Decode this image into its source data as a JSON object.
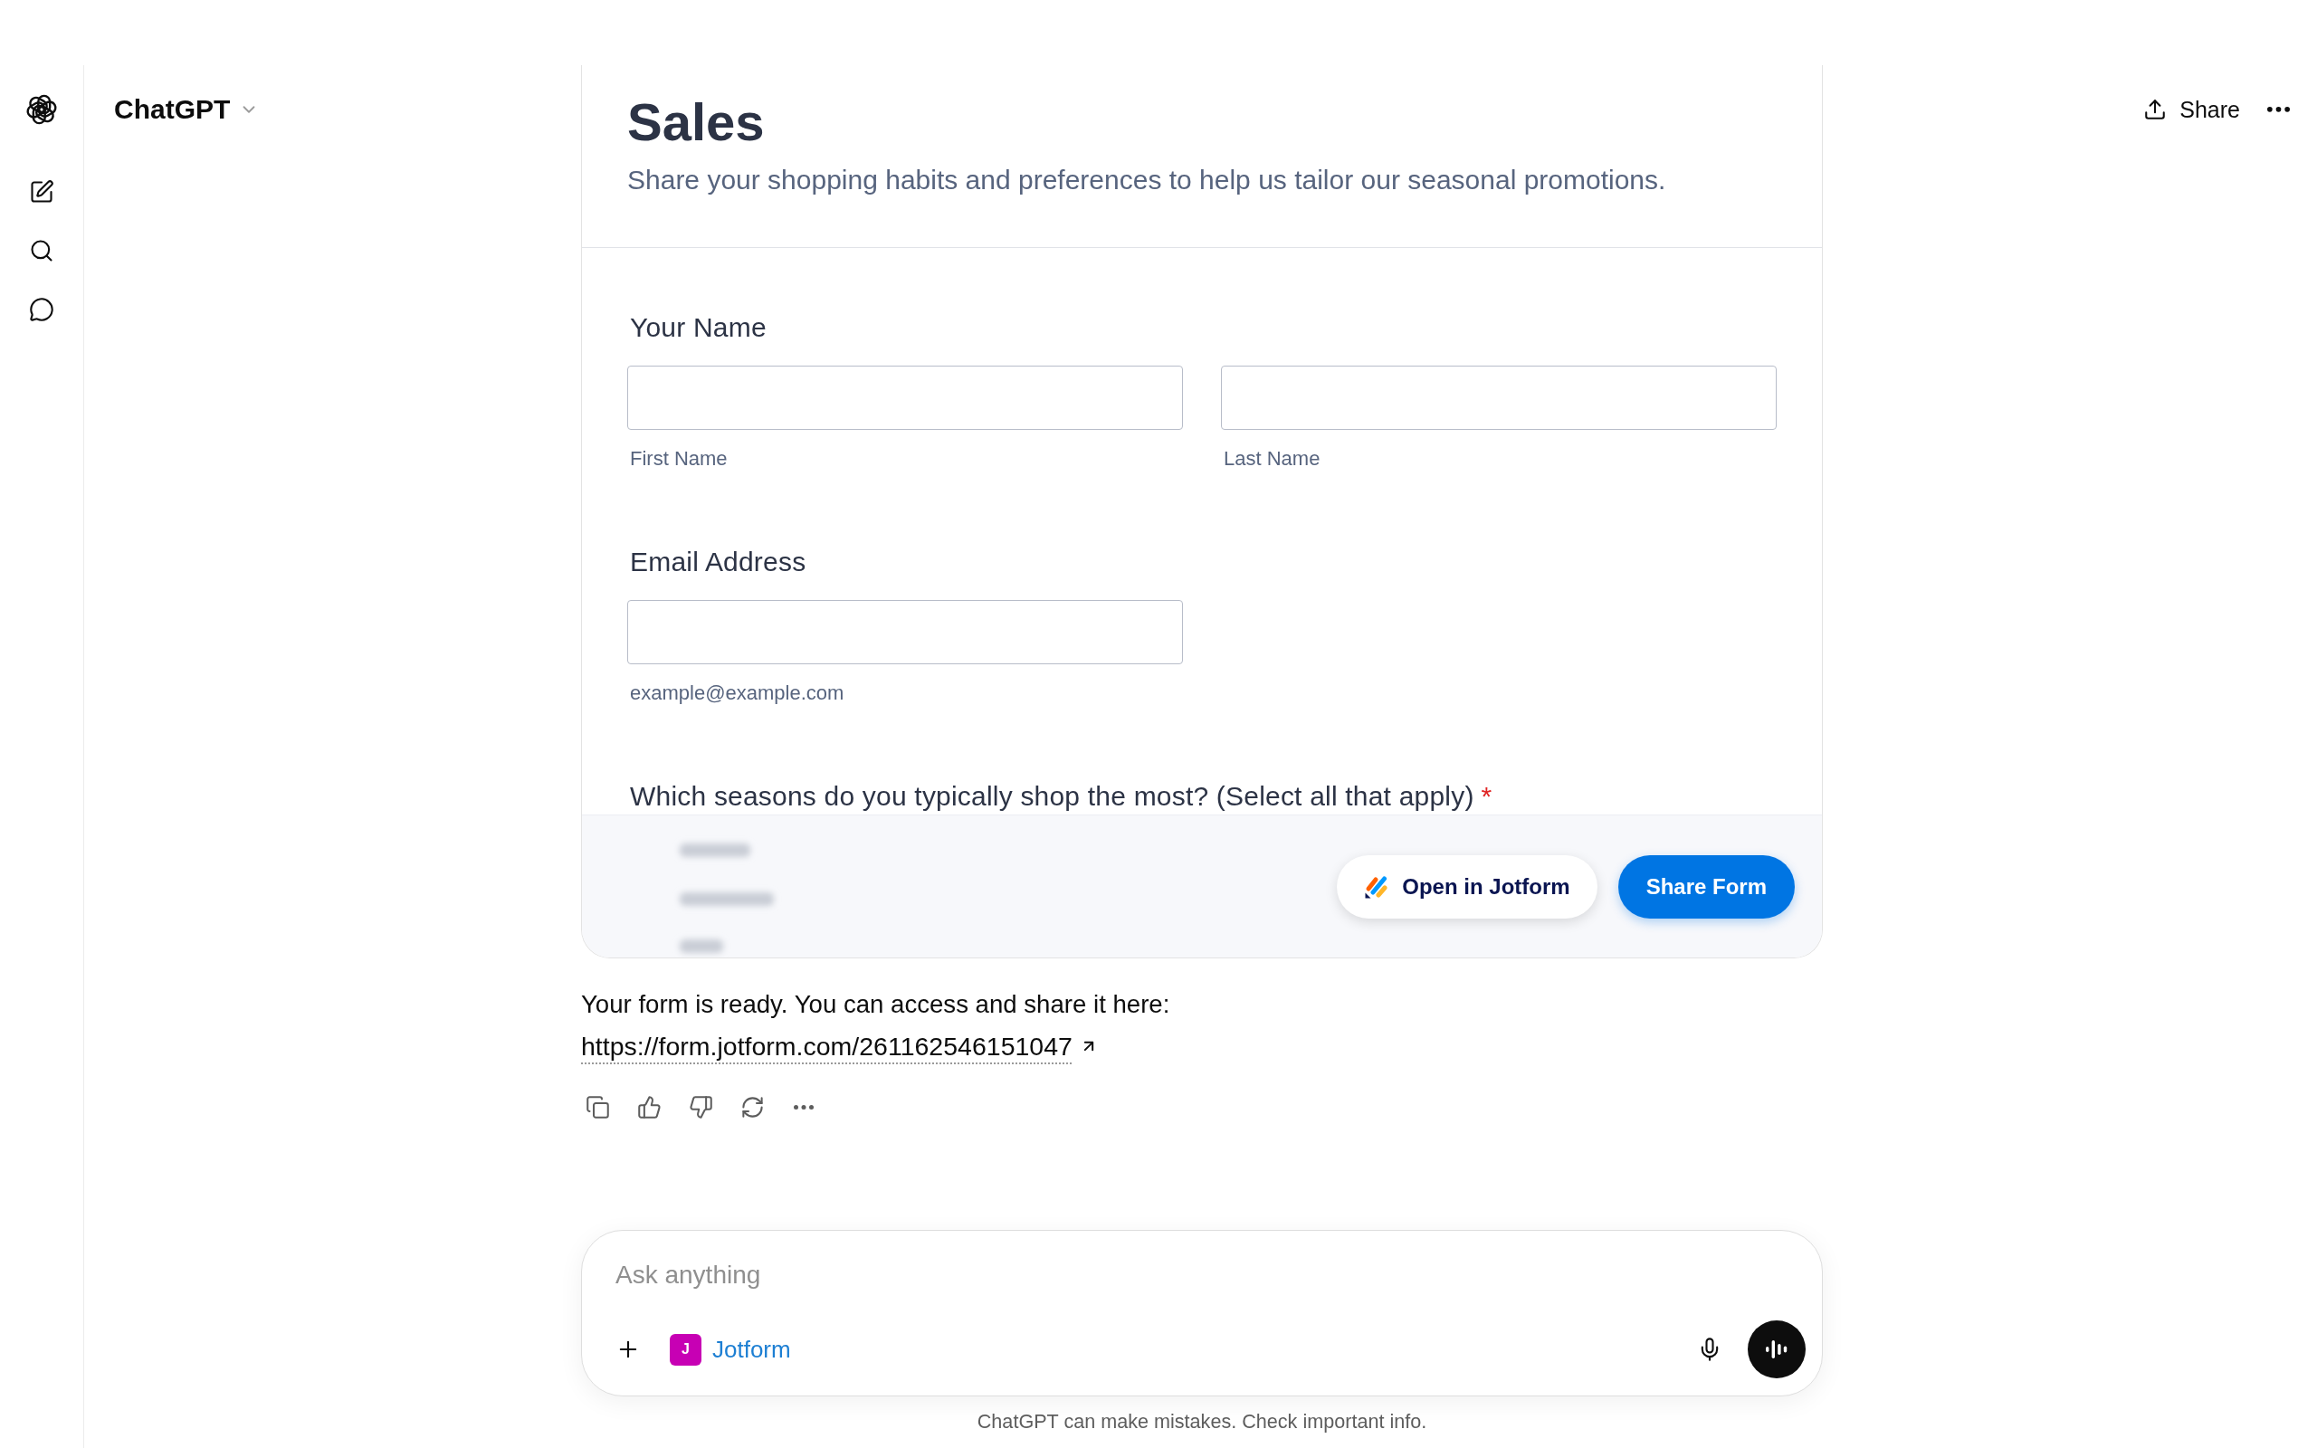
{
  "header": {
    "model_name": "ChatGPT",
    "share_label": "Share"
  },
  "form_card": {
    "title": "Sales",
    "description": "Share your shopping habits and preferences to help us tailor our seasonal promotions.",
    "fields": [
      {
        "kind": "text_inputs",
        "label": "Your Name",
        "inputs": [
          {
            "sublabel": "First Name"
          },
          {
            "sublabel": "Last Name"
          }
        ]
      },
      {
        "kind": "text_inputs",
        "label": "Email Address",
        "inputs": [
          {
            "sublabel": "example@example.com"
          }
        ]
      },
      {
        "kind": "checkbox_group",
        "label": "Which seasons do you typically shop the most? (Select all that apply)",
        "required_mark": "*"
      }
    ],
    "buttons": [
      {
        "kind": "secondary",
        "label": "Open in Jotform"
      },
      {
        "kind": "primary",
        "label": "Share Form"
      }
    ]
  },
  "message": {
    "text": "Your form is ready. You can access and share it here:",
    "link": "https://form.jotform.com/261162546151047"
  },
  "composer": {
    "placeholder": "Ask anything",
    "tool_chip": {
      "initial": "J",
      "label": "Jotform"
    }
  },
  "disclaimer": "ChatGPT can make mistakes. Check important info."
}
